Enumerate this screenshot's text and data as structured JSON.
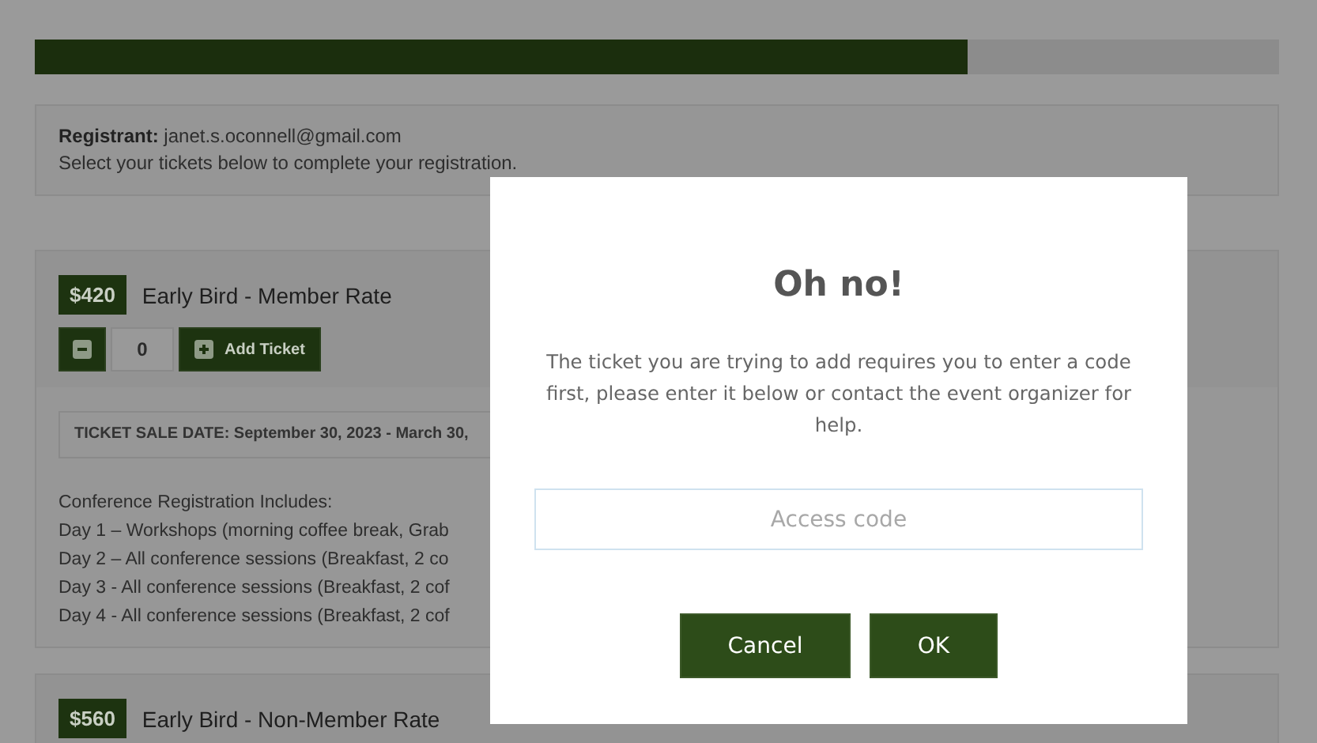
{
  "progress": {
    "level": 0.75
  },
  "registrant": {
    "label": "Registrant:",
    "email": "janet.s.oconnell@gmail.com",
    "instruction": "Select your tickets below to complete your registration."
  },
  "tickets": [
    {
      "price": "$420",
      "name": "Early Bird - Member Rate",
      "quantity": "0",
      "add_label": "Add Ticket",
      "sale_date": "TICKET SALE DATE: September 30, 2023 - March 30,",
      "includes": [
        "Conference Registration Includes:",
        "Day 1 – Workshops (morning coffee break, Grab",
        "Day 2 – All conference sessions (Breakfast, 2 co",
        "Day 3 - All conference sessions (Breakfast, 2 cof",
        "Day 4 - All conference sessions (Breakfast, 2 cof"
      ]
    },
    {
      "price": "$560",
      "name": "Early Bird - Non-Member Rate"
    }
  ],
  "dialog": {
    "title": "Oh no!",
    "message": "The ticket you are trying to add requires you to enter a code first, please enter it below or contact the event organizer for help.",
    "field": {
      "placeholder": "Access code"
    },
    "buttons": [
      "Cancel",
      "OK"
    ]
  }
}
